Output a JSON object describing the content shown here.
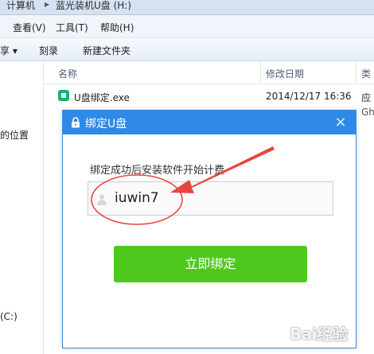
{
  "address": {
    "part1": "计算机",
    "part2": "蓝光装机U盘 (H:)"
  },
  "menu": {
    "view": "查看(V)",
    "tools": "工具(T)",
    "help": "帮助(H)"
  },
  "toolbar": {
    "share": "享 ▾",
    "burn": "刻录",
    "new_folder": "新建文件夹"
  },
  "nav": {
    "location": "的位置",
    "drive": "(C:)"
  },
  "columns": {
    "name": "名称",
    "date": "修改日期",
    "type": "类"
  },
  "file": {
    "name": "U盘绑定.exe",
    "date": "2014/12/17 16:36",
    "type": "应",
    "type2": "Gh"
  },
  "dialog": {
    "title": "绑定U盘",
    "label": "绑定成功后安装软件开始计费",
    "username": "iuwin7",
    "button": "立即绑定"
  },
  "colors": {
    "title_bar": "#2e8ae6",
    "button": "#4fc81e",
    "annotation": "#e8463c"
  },
  "watermark": "Bai经验"
}
